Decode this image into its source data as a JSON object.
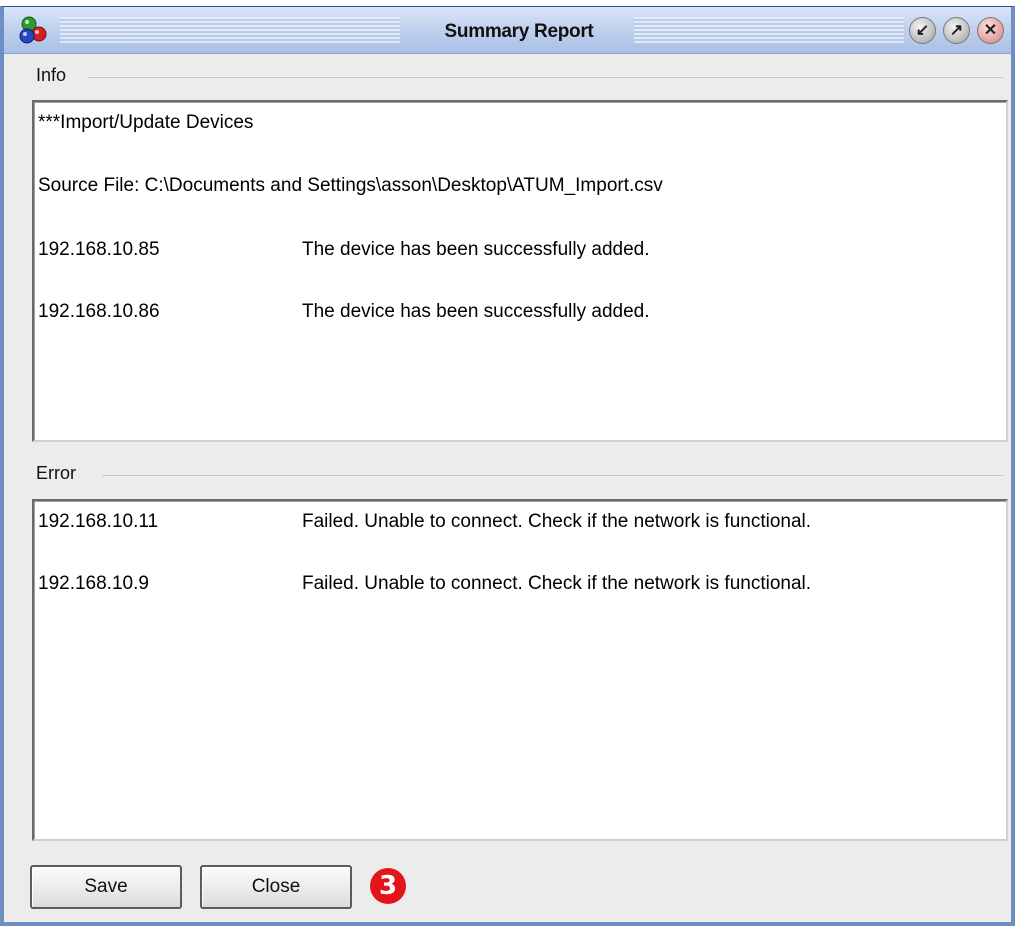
{
  "window": {
    "title": "Summary Report",
    "controls": {
      "minimize": "↙",
      "maximize": "↗",
      "close": "✕"
    }
  },
  "info": {
    "label": "Info",
    "header": "***Import/Update Devices",
    "source_file": "Source File: C:\\Documents and Settings\\asson\\Desktop\\ATUM_Import.csv",
    "rows": [
      {
        "ip": "192.168.10.85",
        "message": "The device has been successfully added."
      },
      {
        "ip": "192.168.10.86",
        "message": "The device has been successfully added."
      }
    ]
  },
  "error": {
    "label": "Error",
    "rows": [
      {
        "ip": "192.168.10.11",
        "message": "Failed. Unable to connect. Check if the network is functional."
      },
      {
        "ip": "192.168.10.9",
        "message": "Failed. Unable to connect. Check if the network is functional."
      }
    ]
  },
  "buttons": {
    "save": "Save",
    "close": "Close"
  },
  "callout": {
    "number": "3",
    "color": "#e4141b"
  }
}
